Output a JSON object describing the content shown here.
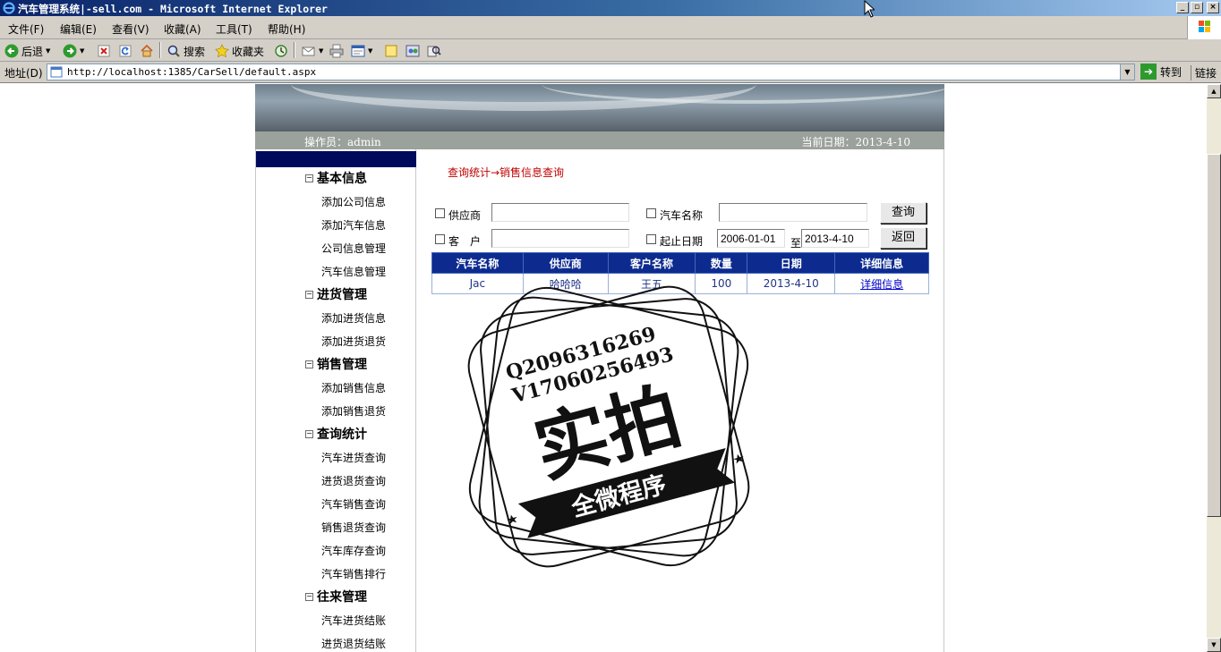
{
  "browser": {
    "window_title": "汽车管理系统|-sell.com - Microsoft Internet Explorer",
    "menu": [
      "文件(F)",
      "编辑(E)",
      "查看(V)",
      "收藏(A)",
      "工具(T)",
      "帮助(H)"
    ],
    "toolbar": {
      "back": "后退",
      "search": "搜索",
      "favorites": "收藏夹"
    },
    "address_label": "地址(D)",
    "url": "http://localhost:1385/CarSell/default.aspx",
    "go_label": "转到",
    "links_label": "链接"
  },
  "header": {
    "operator": "操作员：admin",
    "current_date": "当前日期：2013-4-10"
  },
  "sidebar": {
    "sections": [
      {
        "title": "基本信息",
        "items": [
          "添加公司信息",
          "添加汽车信息",
          "公司信息管理",
          "汽车信息管理"
        ]
      },
      {
        "title": "进货管理",
        "items": [
          "添加进货信息",
          "添加进货退货"
        ]
      },
      {
        "title": "销售管理",
        "items": [
          "添加销售信息",
          "添加销售退货"
        ]
      },
      {
        "title": "查询统计",
        "items": [
          "汽车进货查询",
          "进货退货查询",
          "汽车销售查询",
          "销售退货查询",
          "汽车库存查询",
          "汽车销售排行"
        ]
      },
      {
        "title": "往来管理",
        "items": [
          "汽车进货结账",
          "进货退货结账"
        ]
      }
    ]
  },
  "main": {
    "breadcrumb": "查询统计→销售信息查询",
    "filters": {
      "supplier_label": "供应商",
      "supplier_value": "",
      "car_name_label": "汽车名称",
      "car_name_value": "",
      "customer_label": "客　户",
      "customer_value": "",
      "date_range_label": "起止日期",
      "start_date": "2006-01-01",
      "to_label": "至",
      "end_date": "2013-4-10",
      "query_button": "查询",
      "back_button": "返回"
    },
    "table": {
      "headers": [
        "汽车名称",
        "供应商",
        "客户名称",
        "数量",
        "日期",
        "详细信息"
      ],
      "rows": [
        [
          "Jac",
          "哈哈哈",
          "王五",
          "100",
          "2013-4-10",
          "详细信息"
        ]
      ]
    }
  },
  "watermark": {
    "line1": "Q2096316269",
    "line2": "V17060256493",
    "big": "实拍",
    "ribbon": "全微程序"
  }
}
